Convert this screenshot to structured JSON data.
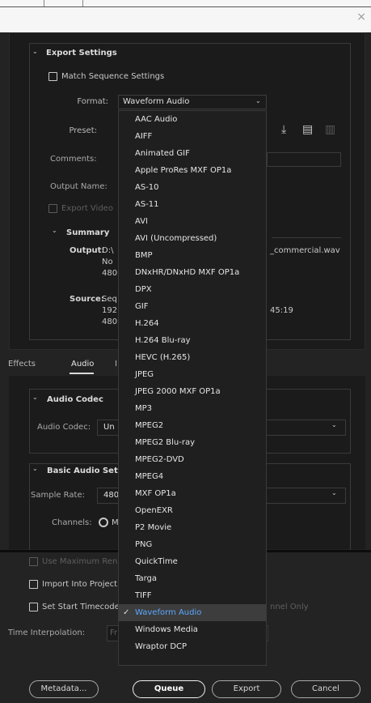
{
  "window": {
    "close_glyph": "×"
  },
  "export_settings": {
    "section_title": "Export Settings",
    "match_sequence_label": "Match Sequence Settings",
    "format_label": "Format:",
    "format_value": "Waveform Audio",
    "preset_label": "Preset:",
    "comments_label": "Comments:",
    "output_name_label": "Output Name:",
    "export_video_label": "Export Video",
    "summary": {
      "title": "Summary",
      "output_label": "Output:",
      "output_line1": "D:\\",
      "output_line1_tail": "_commercial.wav",
      "output_line2": "No",
      "output_line3": "480",
      "source_label": "Source:",
      "source_line1": "Seq",
      "source_line2": "192",
      "source_line2_tail": "45:19",
      "source_line3": "480"
    },
    "preset_icons": [
      "import-preset-icon",
      "save-preset-icon",
      "delete-preset-icon"
    ]
  },
  "format_dropdown": {
    "options": [
      "AAC Audio",
      "AIFF",
      "Animated GIF",
      "Apple ProRes MXF OP1a",
      "AS-10",
      "AS-11",
      "AVI",
      "AVI (Uncompressed)",
      "BMP",
      "DNxHR/DNxHD MXF OP1a",
      "DPX",
      "GIF",
      "H.264",
      "H.264 Blu-ray",
      "HEVC (H.265)",
      "JPEG",
      "JPEG 2000 MXF OP1a",
      "MP3",
      "MPEG2",
      "MPEG2 Blu-ray",
      "MPEG2-DVD",
      "MPEG4",
      "MXF OP1a",
      "OpenEXR",
      "P2 Movie",
      "PNG",
      "QuickTime",
      "Targa",
      "TIFF",
      "Waveform Audio",
      "Windows Media",
      "Wraptor DCP"
    ],
    "selected": "Waveform Audio",
    "check_glyph": "✓"
  },
  "tabs": {
    "effects": "Effects",
    "audio": "Audio",
    "partial": "I"
  },
  "audio": {
    "codec_section": "Audio Codec",
    "codec_label": "Audio Codec:",
    "codec_value": "Un",
    "basic_section": "Basic Audio Setti",
    "sample_rate_label": "Sample Rate:",
    "sample_rate_value": "480",
    "channels_label": "Channels:",
    "channels_value": "M"
  },
  "bottom": {
    "use_max_render": "Use Maximum Ren",
    "import_into_project": "Import Into Project",
    "set_start_timecode": "Set Start Timecode",
    "channel_only_tail": "nnel Only",
    "time_interpolation_label": "Time Interpolation:",
    "time_interpolation_value": "Fr"
  },
  "buttons": {
    "metadata": "Metadata...",
    "queue": "Queue",
    "export": "Export",
    "cancel": "Cancel"
  }
}
